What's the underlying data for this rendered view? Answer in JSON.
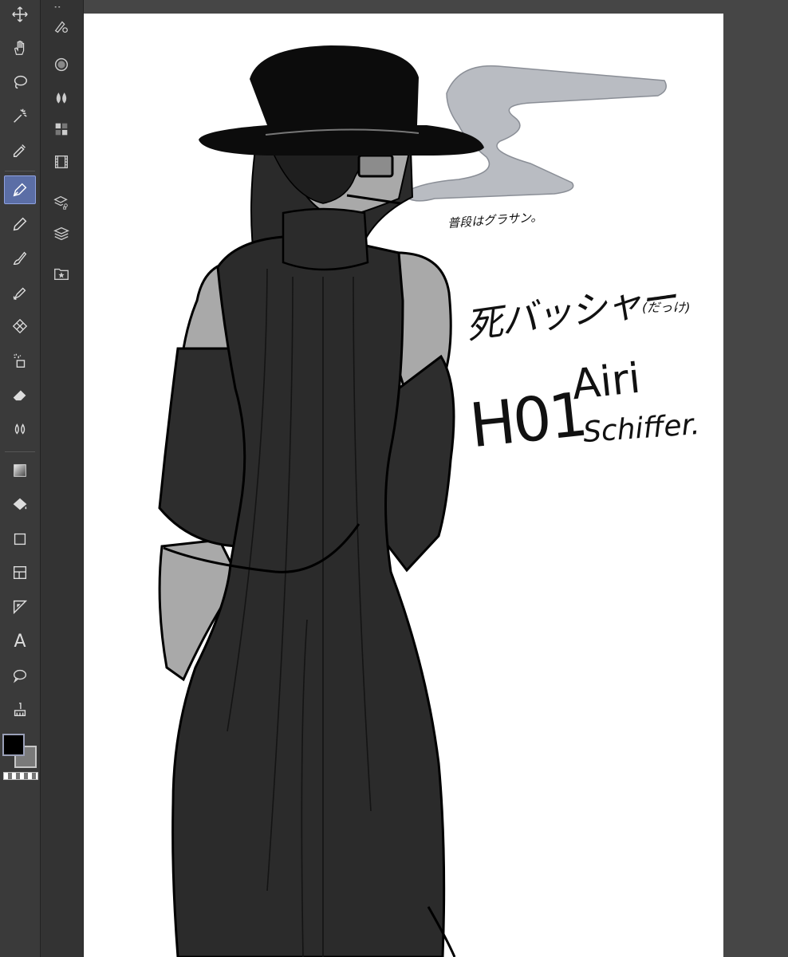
{
  "toolbar": {
    "tools": [
      {
        "id": "move",
        "icon": "move-icon"
      },
      {
        "id": "hand",
        "icon": "hand-icon"
      },
      {
        "id": "lasso",
        "icon": "lasso-icon"
      },
      {
        "id": "magic-wand",
        "icon": "magic-wand-icon"
      },
      {
        "id": "eyedropper",
        "icon": "eyedropper-icon"
      },
      {
        "id": "pen",
        "icon": "pen-icon",
        "active": true
      },
      {
        "id": "pencil",
        "icon": "pencil-icon"
      },
      {
        "id": "brush",
        "icon": "brush-icon"
      },
      {
        "id": "decoration",
        "icon": "decoration-icon"
      },
      {
        "id": "pattern",
        "icon": "pattern-icon"
      },
      {
        "id": "airbrush",
        "icon": "airbrush-icon"
      },
      {
        "id": "eraser",
        "icon": "eraser-icon"
      },
      {
        "id": "blend",
        "icon": "blend-icon"
      },
      {
        "id": "gradient",
        "icon": "gradient-icon"
      },
      {
        "id": "fill",
        "icon": "fill-icon"
      },
      {
        "id": "figure",
        "icon": "figure-icon"
      },
      {
        "id": "frame",
        "icon": "frame-icon"
      },
      {
        "id": "ruler",
        "icon": "ruler-icon"
      },
      {
        "id": "text",
        "icon": "text-icon",
        "glyph": "A"
      },
      {
        "id": "balloon",
        "icon": "balloon-icon"
      },
      {
        "id": "correct-line",
        "icon": "correct-line-icon"
      }
    ],
    "colors": {
      "main": "#000000",
      "sub": "#7a7a7a"
    }
  },
  "panel": {
    "icons": [
      "pen-settings-icon",
      "navigator-icon",
      "water-icon",
      "color-set-icon",
      "animation-icon",
      "layer-property-icon",
      "layers-icon",
      "material-icon"
    ]
  },
  "canvas": {
    "background": "#ffffff",
    "annotations": {
      "note_sunglasses": "普段はグラサン。",
      "title_jp": "死バッシャー",
      "title_jp_suffix": "(だっけ)",
      "code": "H01",
      "name_first": "Airi",
      "name_last": "Schiffer."
    }
  }
}
